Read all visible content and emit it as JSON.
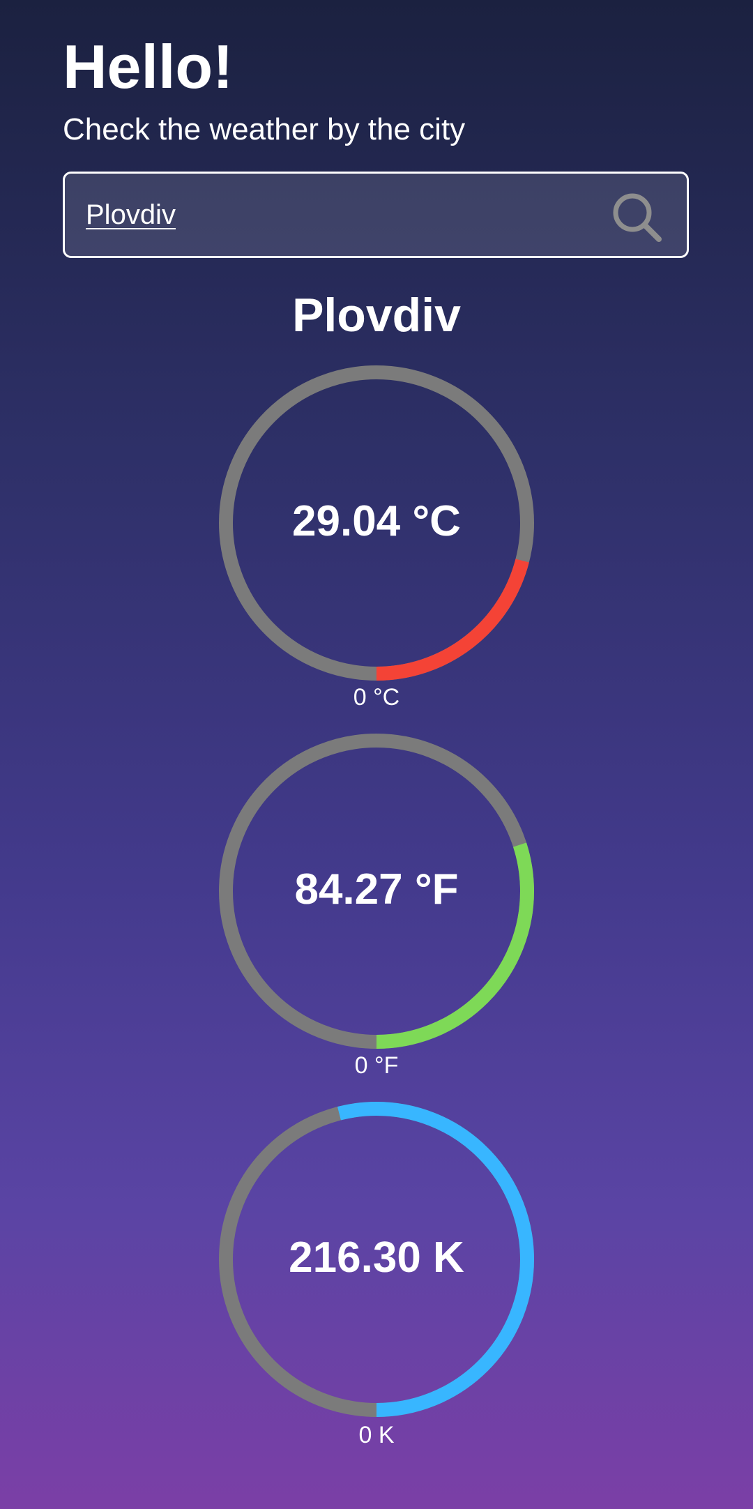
{
  "header": {
    "greeting": "Hello!",
    "subtitle": "Check the weather by the city"
  },
  "search": {
    "value": "Plovdiv",
    "icon": "search-icon"
  },
  "city": {
    "name": "Plovdiv"
  },
  "gauges": [
    {
      "id": "celsius",
      "value_label": "29.04 °C",
      "min_label": "0 °C",
      "fill_fraction": 0.21,
      "color": "#f44336"
    },
    {
      "id": "fahrenheit",
      "value_label": "84.27 °F",
      "min_label": "0 °F",
      "fill_fraction": 0.3,
      "color": "#7ed957"
    },
    {
      "id": "kelvin",
      "value_label": "216.30 K",
      "min_label": "0 K",
      "fill_fraction": 0.54,
      "color": "#38b6ff"
    }
  ],
  "colors": {
    "track": "#7b7b7b",
    "text": "#ffffff"
  }
}
